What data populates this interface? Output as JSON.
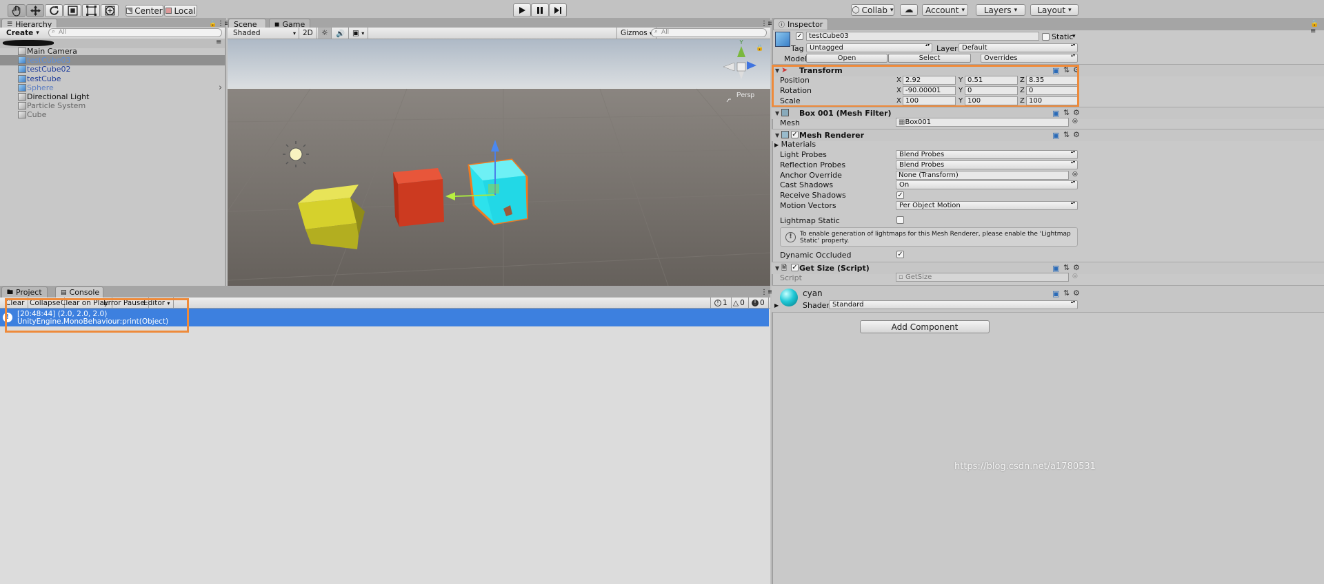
{
  "toolbar": {
    "center": "Center",
    "local": "Local",
    "collab": "Collab",
    "account": "Account",
    "layers": "Layers",
    "layout": "Layout"
  },
  "hierarchy": {
    "tab": "Hierarchy",
    "create": "Create",
    "search_placeholder": "All",
    "scene_name": "",
    "items": [
      {
        "label": "Main Camera"
      },
      {
        "label": "testCube03"
      },
      {
        "label": "testCube02"
      },
      {
        "label": "testCube"
      },
      {
        "label": "Sphere"
      },
      {
        "label": "Directional Light"
      },
      {
        "label": "Particle System"
      },
      {
        "label": "Cube"
      }
    ]
  },
  "scene": {
    "tab_scene": "Scene",
    "tab_game": "Game",
    "shading": "Shaded",
    "mode2d": "2D",
    "gizmos": "Gizmos",
    "search_placeholder": "All",
    "persp": "Persp"
  },
  "bottom": {
    "tab_project": "Project",
    "tab_console": "Console",
    "btn_clear": "Clear",
    "btn_collapse": "Collapse",
    "btn_clear_on_play": "Clear on Play",
    "btn_error_pause": "Error Pause",
    "btn_editor": "Editor",
    "count_info": "1",
    "count_warn": "0",
    "count_error": "0",
    "log_line1": "[20:48:44] (2.0, 2.0, 2.0)",
    "log_line2": "UnityEngine.MonoBehaviour:print(Object)"
  },
  "inspector": {
    "tab": "Inspector",
    "object_name": "testCube03",
    "static_label": "Static",
    "tag_label": "Tag",
    "tag_value": "Untagged",
    "layer_label": "Layer",
    "layer_value": "Default",
    "model_label": "Model",
    "open": "Open",
    "select": "Select",
    "overrides": "Overrides",
    "transform": {
      "title": "Transform",
      "rows": [
        {
          "label": "Position",
          "x": "2.92",
          "y": "0.51",
          "z": "8.35"
        },
        {
          "label": "Rotation",
          "x": "-90.00001",
          "y": "0",
          "z": "0"
        },
        {
          "label": "Scale",
          "x": "100",
          "y": "100",
          "z": "100"
        }
      ]
    },
    "axes": {
      "x": "X",
      "y": "Y",
      "z": "Z"
    },
    "mesh_filter": {
      "title": "Box 001 (Mesh Filter)",
      "mesh_label": "Mesh",
      "mesh_value": "Box001"
    },
    "mesh_renderer": {
      "title": "Mesh Renderer",
      "materials": "Materials",
      "rows": [
        {
          "label": "Light Probes",
          "value": "Blend Probes"
        },
        {
          "label": "Reflection Probes",
          "value": "Blend Probes"
        },
        {
          "label": "Anchor Override",
          "value": "None (Transform)"
        },
        {
          "label": "Cast Shadows",
          "value": "On"
        },
        {
          "label": "Receive Shadows",
          "value": ""
        },
        {
          "label": "Motion Vectors",
          "value": "Per Object Motion"
        }
      ],
      "lightmap_static": "Lightmap Static",
      "info": "To enable generation of lightmaps for this Mesh Renderer, please enable the 'Lightmap Static' property.",
      "dynamic_occluded": "Dynamic Occluded"
    },
    "script_comp": {
      "title": "Get Size (Script)",
      "script_label": "Script",
      "script_value": "GetSize"
    },
    "material": {
      "name": "cyan",
      "shader_label": "Shader",
      "shader_value": "Standard"
    },
    "add_component": "Add Component"
  },
  "watermark": "https://blog.csdn.net/a1780531",
  "colors": {
    "highlight": "#ee8a3a",
    "selection": "#3d80df",
    "cube_cyan": "#2fe4ee",
    "cube_red": "#d83a22",
    "cube_yellow": "#c9c423",
    "sky": "#c9d2dc",
    "ground": "#6e6963"
  }
}
